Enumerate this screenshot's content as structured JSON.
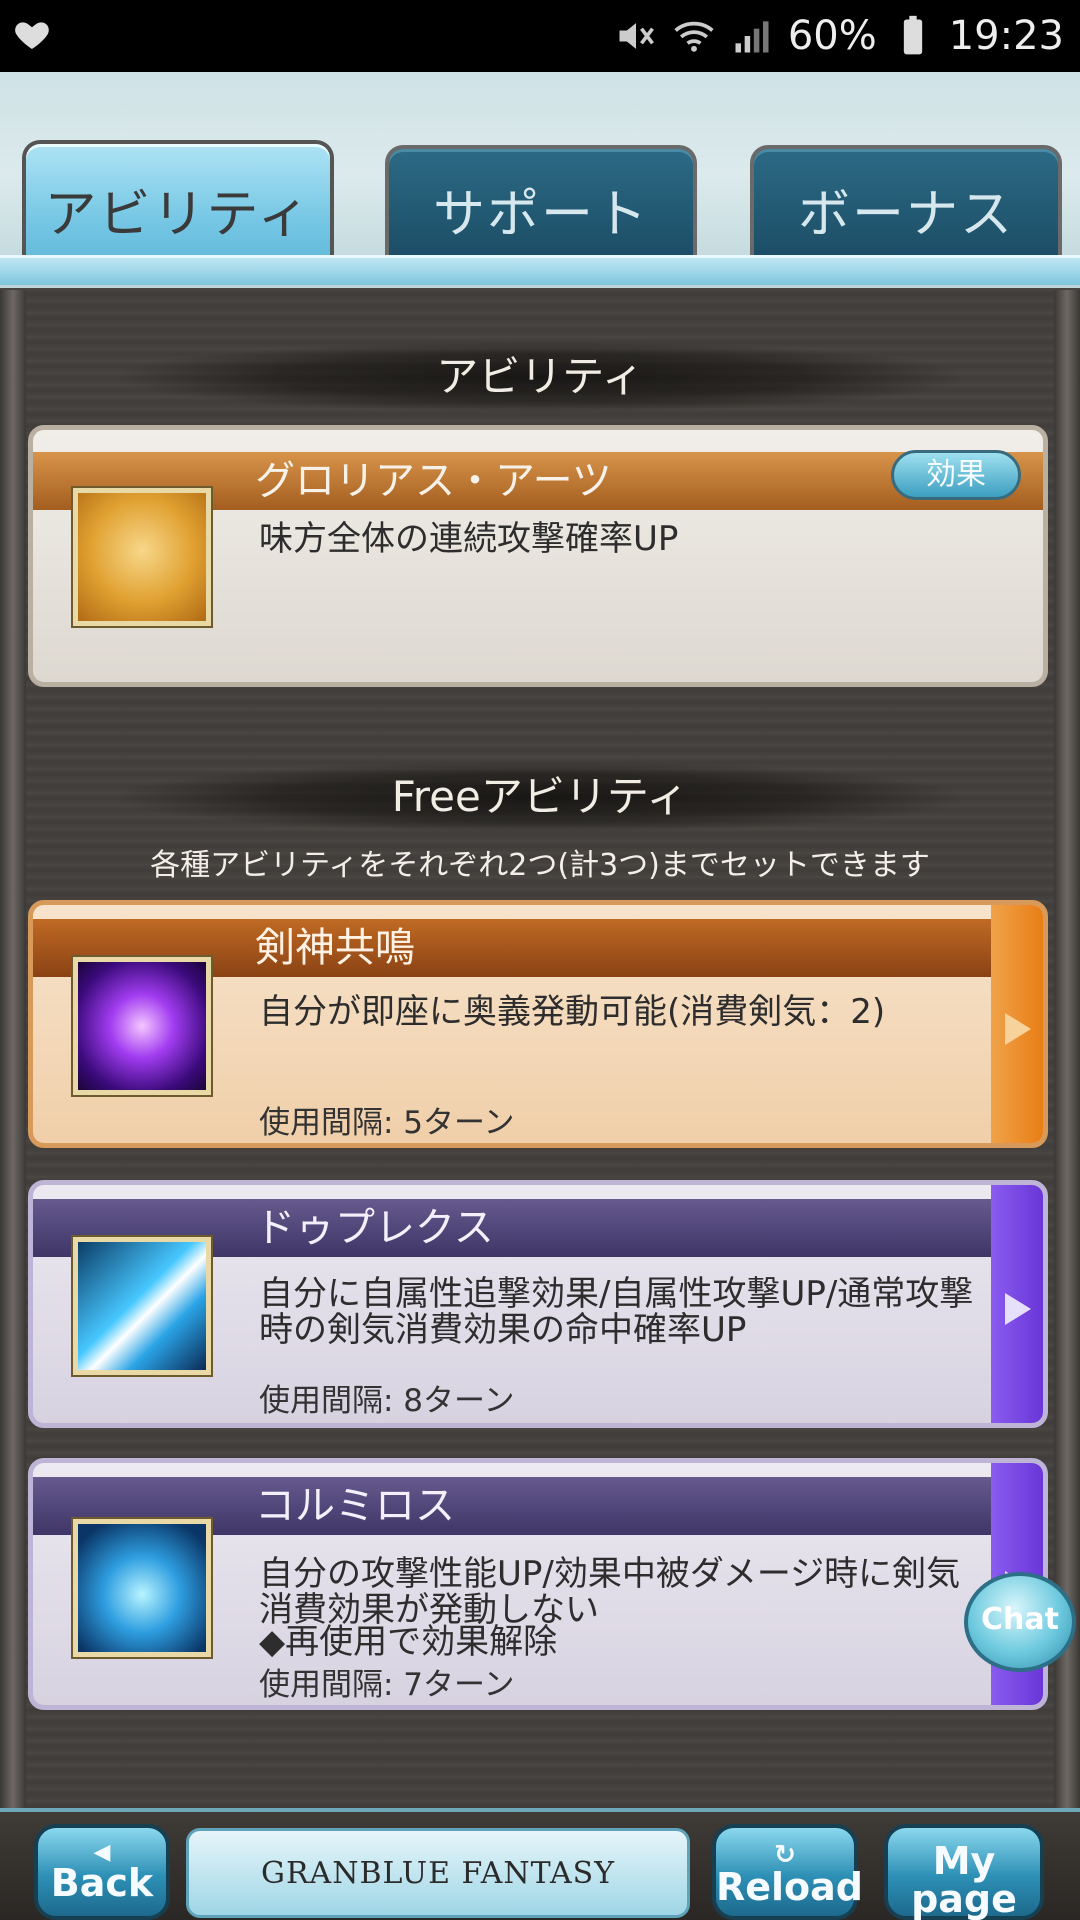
{
  "status_bar": {
    "battery": "60%",
    "time": "19:23"
  },
  "tabs": [
    {
      "label": "アビリティ"
    },
    {
      "label": "サポート"
    },
    {
      "label": "ボーナス"
    }
  ],
  "sections": {
    "ability_title": "アビリティ",
    "free_title": "Freeアビリティ",
    "free_note": "各種アビリティをそれぞれ2つ(計3つ)までセットできます"
  },
  "main_ability": {
    "name": "グロリアス・アーツ",
    "description": "味方全体の連続攻撃確率UP",
    "effect_button": "効果"
  },
  "free_abilities": [
    {
      "name": "剣神共鳴",
      "description": "自分が即座に奥義発動可能(消費剣気：2)",
      "interval": "使用間隔: 5ターン"
    },
    {
      "name": "ドゥプレクス",
      "description": "自分に自属性追撃効果/自属性攻撃UP/通常攻撃時の剣気消費効果の命中確率UP",
      "interval": "使用間隔: 8ターン"
    },
    {
      "name": "コルミロス",
      "description": "自分の攻撃性能UP/効果中被ダメージ時に剣気消費効果が発動しない",
      "note": "◆再使用で効果解除",
      "interval": "使用間隔: 7ターン"
    }
  ],
  "chat_label": "Chat",
  "bottom_nav": {
    "back": "Back",
    "logo": "GRANBLUE FANTASY",
    "reload": "Reload",
    "mypage_line1": "My",
    "mypage_line2": "page"
  }
}
